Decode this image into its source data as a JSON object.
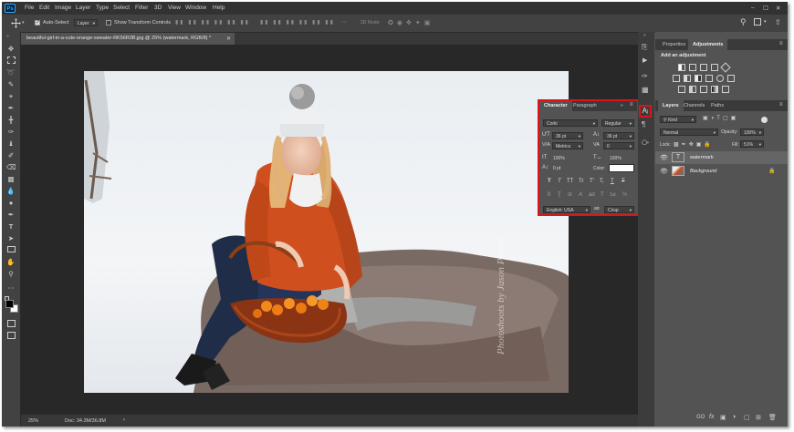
{
  "app": {
    "logo": "Ps",
    "menu": [
      "File",
      "Edit",
      "Image",
      "Layer",
      "Type",
      "Select",
      "Filter",
      "3D",
      "View",
      "Window",
      "Help"
    ],
    "window_controls": [
      "–",
      "☐",
      "✕"
    ]
  },
  "options_bar": {
    "auto_select_label": "Auto-Select",
    "auto_select_value": "Layer",
    "transform_label": "Show Transform Controls",
    "mode_label": "3D Mode:"
  },
  "document": {
    "tab_title": "beautiful-girl-in-a-cute-orange-sweater-RK56R3B.jpg @ 25% (watermark, RGB/8) *",
    "zoom": "25%",
    "doc_info": "Doc: 34.3M/36.8M",
    "watermark": "Photoshoots by Jason Parker"
  },
  "properties_panel": {
    "tabs": [
      "Properties",
      "Adjustments"
    ],
    "add_adjustment_label": "Add an adjustment"
  },
  "character_panel": {
    "tabs": [
      "Character",
      "Paragraph"
    ],
    "font_family": "Corki",
    "font_style": "Regular",
    "font_size": "36 pt",
    "leading": "36 pt",
    "kerning": "Metrics",
    "tracking": "0",
    "vertical_scale": "100%",
    "horizontal_scale": "100%",
    "baseline_shift": "0 pt",
    "color_label": "Color:",
    "text_color": "#ffffff",
    "style_buttons": [
      "T",
      "T",
      "TT",
      "Tr",
      "T'",
      "T,",
      "T",
      "T"
    ],
    "opentype_buttons": [
      "fi",
      "Ţ",
      "st",
      "A",
      "ad",
      "T",
      "1st",
      "½"
    ],
    "language": "English: USA",
    "aa_label": "aɑ",
    "antialias": "Crisp"
  },
  "layers_panel": {
    "tabs": [
      "Layers",
      "Channels",
      "Paths"
    ],
    "kind_label": "Kind",
    "blend_mode": "Normal",
    "opacity_label": "Opacity:",
    "opacity": "100%",
    "lock_label": "Lock:",
    "fill_label": "Fill:",
    "fill": "51%",
    "layers": [
      {
        "name": "watermark",
        "type": "T"
      },
      {
        "name": "Background",
        "type": "image"
      }
    ]
  },
  "colors": {
    "accent_highlight": "#d9151b",
    "ps_blue": "#31a8ff",
    "panel_bg": "#535353"
  }
}
